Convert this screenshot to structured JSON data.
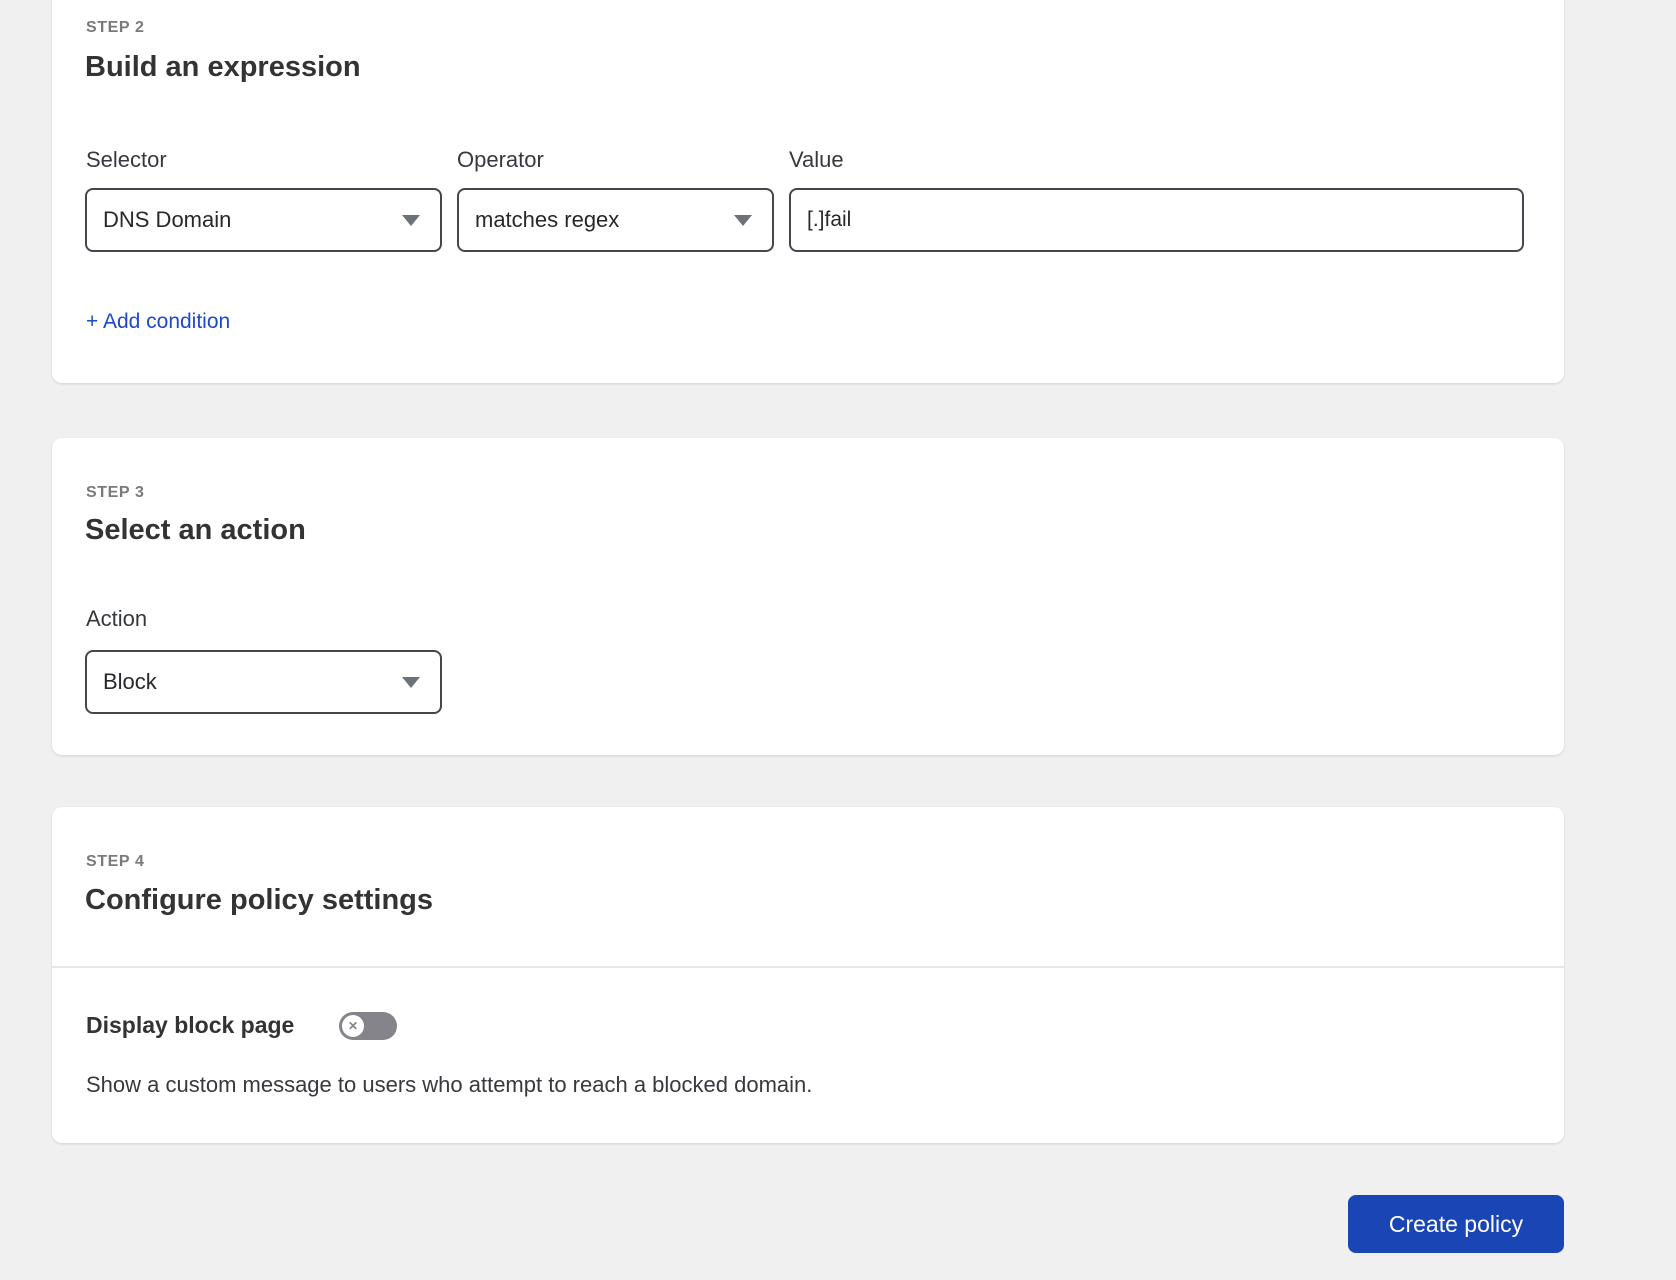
{
  "colors": {
    "accent_blue": "#1a45b5",
    "link_blue": "#1e49c9",
    "background_gray": "#f0f0f1",
    "toggle_off_gray": "#84848a"
  },
  "step2": {
    "eyebrow": "STEP 2",
    "title": "Build an expression",
    "fields": {
      "selector": {
        "label": "Selector",
        "value": "DNS Domain"
      },
      "operator": {
        "label": "Operator",
        "value": "matches regex"
      },
      "value": {
        "label": "Value",
        "value": "[.]fail"
      }
    },
    "add_condition_label": "+ Add condition"
  },
  "step3": {
    "eyebrow": "STEP 3",
    "title": "Select an action",
    "action": {
      "label": "Action",
      "value": "Block"
    }
  },
  "step4": {
    "eyebrow": "STEP 4",
    "title": "Configure policy settings",
    "display_block_page": {
      "label": "Display block page",
      "toggle_state": "off",
      "toggle_icon": "✕",
      "description": "Show a custom message to users who attempt to reach a blocked domain."
    }
  },
  "footer": {
    "create_button_label": "Create policy"
  }
}
